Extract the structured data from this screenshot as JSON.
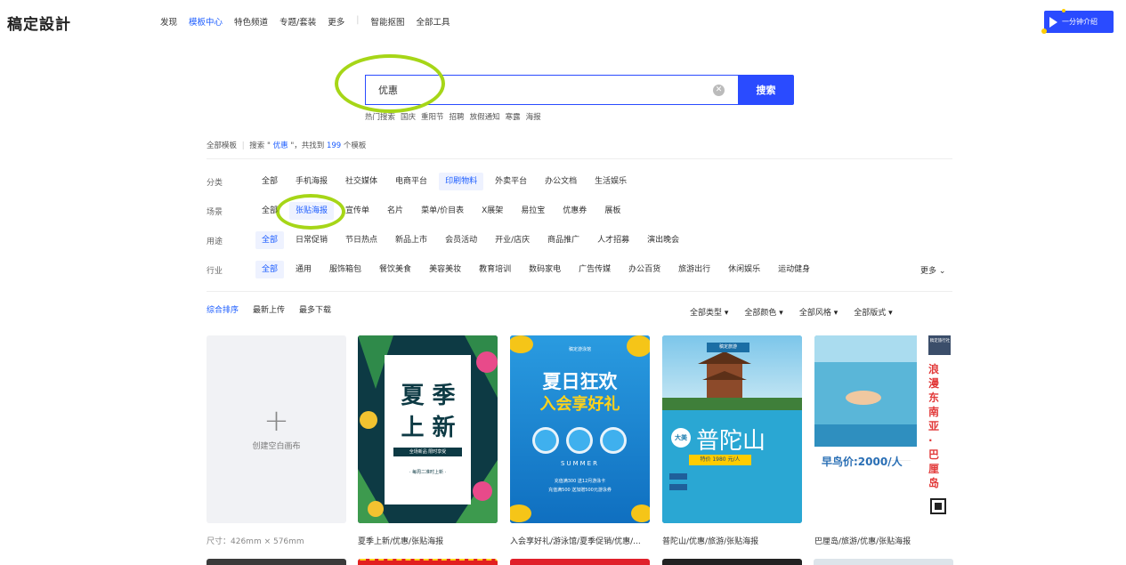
{
  "logo": "稿定設計",
  "nav": {
    "items": [
      "发现",
      "模板中心",
      "特色频道",
      "专题/套装",
      "更多"
    ],
    "active": "模板中心",
    "extra": [
      "智能抠图",
      "全部工具"
    ]
  },
  "intro_button": "一分钟介绍",
  "search": {
    "value": "优惠",
    "button": "搜索",
    "hot_label": "热门搜索",
    "hot_terms": [
      "国庆",
      "重阳节",
      "招聘",
      "放假通知",
      "寒露",
      "海报"
    ]
  },
  "summary": {
    "prefix": "全部模板",
    "sep": "|",
    "text_before": "搜索 \"",
    "keyword": " 优惠 ",
    "text_mid": "\"，共找到",
    "count": " 199 ",
    "text_after": "个模板"
  },
  "filters": [
    {
      "label": "分类",
      "items": [
        "全部",
        "手机海报",
        "社交媒体",
        "电商平台",
        "印刷物料",
        "外卖平台",
        "办公文档",
        "生活娱乐"
      ],
      "selected": 4
    },
    {
      "label": "场景",
      "items": [
        "全部",
        "张贴海报",
        "宣传单",
        "名片",
        "菜单/价目表",
        "X展架",
        "易拉宝",
        "优惠券",
        "展板"
      ],
      "selected": 1
    },
    {
      "label": "用途",
      "items": [
        "全部",
        "日常促销",
        "节日热点",
        "新品上市",
        "会员活动",
        "开业/店庆",
        "商品推广",
        "人才招募",
        "演出晚会"
      ],
      "selected": 0
    },
    {
      "label": "行业",
      "items": [
        "全部",
        "通用",
        "服饰箱包",
        "餐饮美食",
        "美容美妆",
        "教育培训",
        "数码家电",
        "广告传媒",
        "办公百货",
        "旅游出行",
        "休闲娱乐",
        "运动健身"
      ],
      "selected": 0
    }
  ],
  "more_label": "更多 ⌄",
  "sort": {
    "items": [
      "综合排序",
      "最新上传",
      "最多下载"
    ],
    "active": 0
  },
  "dropdowns": [
    "全部类型",
    "全部颜色",
    "全部风格",
    "全部版式"
  ],
  "cards": [
    {
      "type": "blank",
      "plus": "+",
      "label": "创建空白画布",
      "caption": "尺寸：426mm × 576mm"
    },
    {
      "type": "poster1",
      "title": [
        "夏",
        "季",
        "上",
        "新"
      ],
      "sub": "全场新品 限时享受",
      "footer": "· 每周二准时上新 ·",
      "caption": "夏季上新/优惠/张贴海报"
    },
    {
      "type": "poster2",
      "top": "稿定游泳馆",
      "title1": "夏日狂欢",
      "title2": "入会享好礼",
      "eng": "SUMMER",
      "line1": "充值满300 送12月游泳卡",
      "line2": "充值满500 送加赠500元游泳券",
      "caption": "入会享好礼/游泳馆/夏季促销/优惠/..."
    },
    {
      "type": "poster3",
      "tag": "稿定旅游",
      "title": "普陀山",
      "prefix": "大美",
      "price": "特价 1980 元/人",
      "caption": "普陀山/优惠/旅游/张贴海报"
    },
    {
      "type": "poster4",
      "tag": "稿定旅行社",
      "title": "浪漫东南亚·巴厘岛",
      "price": "早鸟价:2000/人",
      "caption": "巴厘岛/旅游/优惠/张贴海报"
    }
  ],
  "colors": {
    "accent": "#2a4bff",
    "highlight_circle": "#a6d617"
  }
}
